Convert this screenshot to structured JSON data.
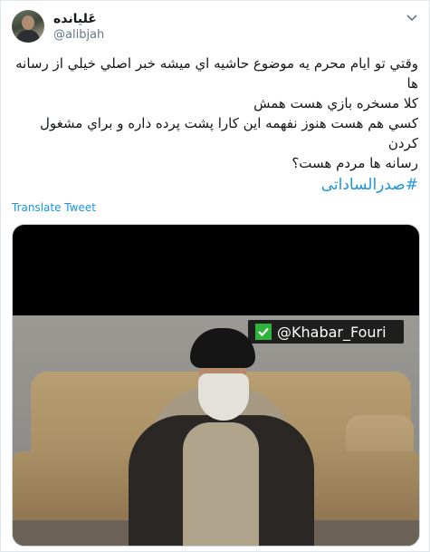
{
  "user": {
    "display_name": "عَلیانده",
    "handle": "@alibjah"
  },
  "tweet": {
    "lines": [
      "وقتي تو ايام محرم يه موضوع حاشيه اي ميشه خبر اصلي خيلي از رسانه",
      "ها",
      "کلا مسخره بازي هست همش",
      "کسي هم هست هنوز نفهمه اين کارا پشت پرده داره و براي مشغول کردن",
      "رسانه ها مردم هست؟"
    ],
    "hashtag": "#صدرالساداتی"
  },
  "translate_label": "Translate Tweet",
  "media": {
    "watermark": "@Khabar_Fouri"
  },
  "colors": {
    "link": "#1b95e0",
    "text": "#14171a",
    "muted": "#657786",
    "watermark_check": "#30b33b"
  },
  "icons": {
    "menu": "chevron-down-icon",
    "watermark": "check-icon"
  }
}
